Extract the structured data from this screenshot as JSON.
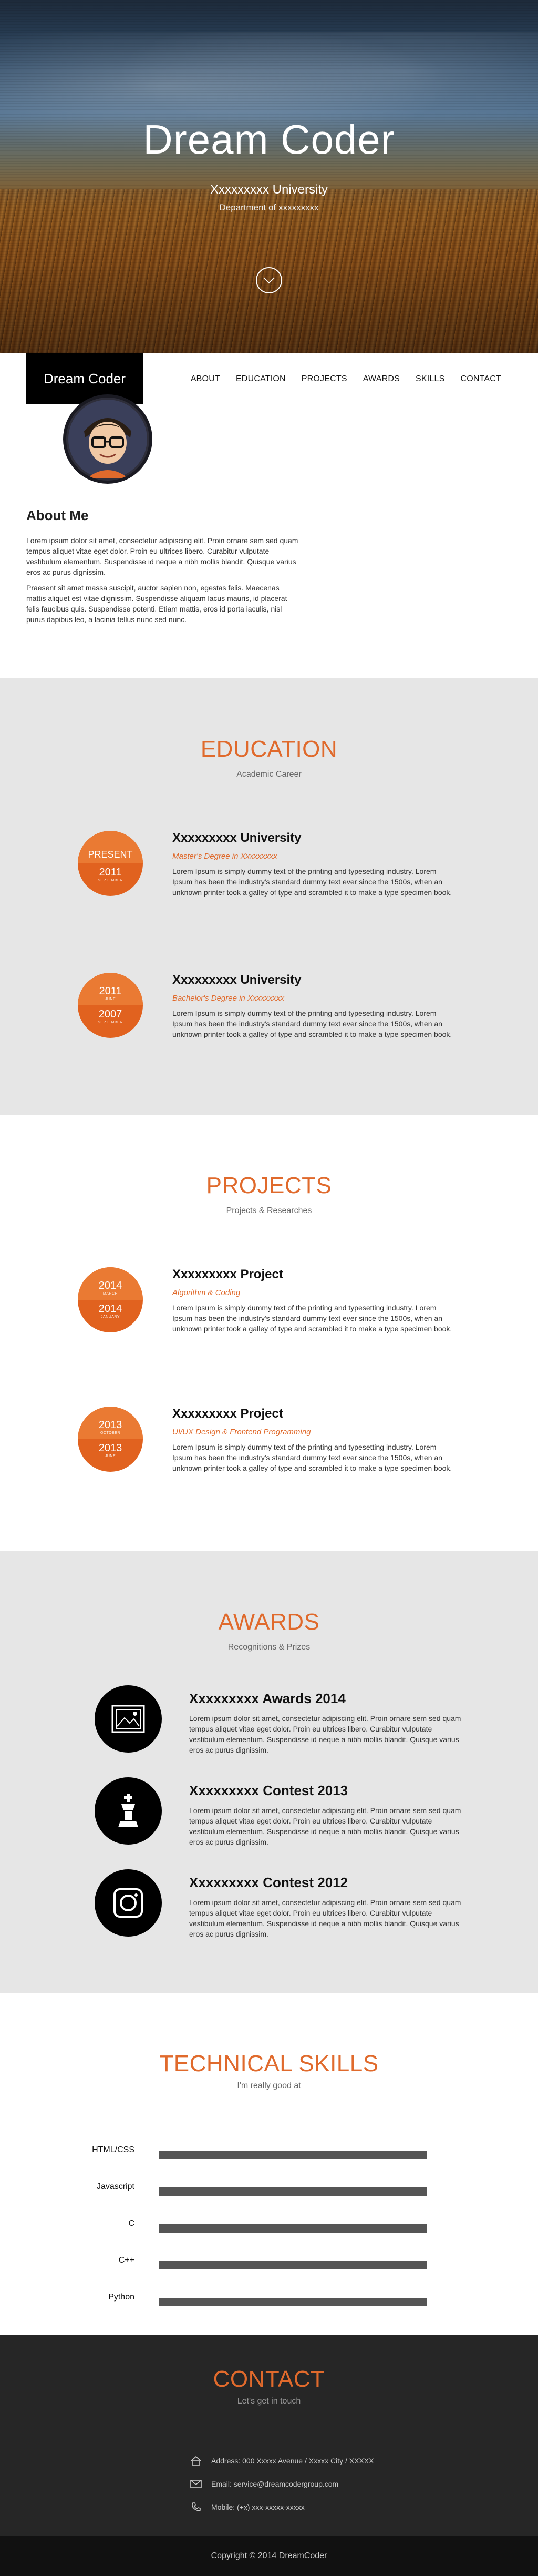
{
  "hero": {
    "title": "Dream Coder",
    "university": "Xxxxxxxxx University",
    "department": "Department of xxxxxxxxx",
    "scroll_icon": "chevron-down-icon"
  },
  "nav": {
    "brand": "Dream Coder",
    "items": [
      "ABOUT",
      "EDUCATION",
      "PROJECTS",
      "AWARDS",
      "SKILLS",
      "CONTACT"
    ]
  },
  "about": {
    "title": "About Me",
    "paragraphs": [
      "Lorem ipsum dolor sit amet, consectetur adipiscing elit. Proin ornare sem sed quam tempus aliquet vitae eget dolor. Proin eu ultrices libero. Curabitur vulputate vestibulum elementum. Suspendisse id neque a nibh mollis blandit. Quisque varius eros ac purus dignissim.",
      "Praesent sit amet massa suscipit, auctor sapien non, egestas felis. Maecenas mattis aliquet est vitae dignissim. Suspendisse aliquam lacus mauris, id placerat felis faucibus quis. Suspendisse potenti. Etiam mattis, eros id porta iaculis, nisl purus dapibus leo, a lacinia tellus nunc sed nunc."
    ]
  },
  "education": {
    "title": "EDUCATION",
    "subtitle": "Academic Career",
    "items": [
      {
        "top": "PRESENT",
        "top_small": "",
        "bottom": "2011",
        "bottom_small": "SEPTEMBER",
        "name": "Xxxxxxxxx University",
        "role": "Master's Degree in Xxxxxxxxx",
        "text": "Lorem Ipsum is simply dummy text of the printing and typesetting industry. Lorem Ipsum has been the industry's standard dummy text ever since the 1500s, when an unknown printer took a galley of type and scrambled it to make a type specimen book."
      },
      {
        "top": "2011",
        "top_small": "JUNE",
        "bottom": "2007",
        "bottom_small": "SEPTEMBER",
        "name": "Xxxxxxxxx University",
        "role": "Bachelor's Degree in Xxxxxxxxx",
        "text": "Lorem Ipsum is simply dummy text of the printing and typesetting industry. Lorem Ipsum has been the industry's standard dummy text ever since the 1500s, when an unknown printer took a galley of type and scrambled it to make a type specimen book."
      }
    ]
  },
  "projects": {
    "title": "PROJECTS",
    "subtitle": "Projects & Researches",
    "items": [
      {
        "top": "2014",
        "top_small": "MARCH",
        "bottom": "2014",
        "bottom_small": "JANUARY",
        "name": "Xxxxxxxxx Project",
        "role": "Algorithm & Coding",
        "text": "Lorem Ipsum is simply dummy text of the printing and typesetting industry. Lorem Ipsum has been the industry's standard dummy text ever since the 1500s, when an unknown printer took a galley of type and scrambled it to make a type specimen book."
      },
      {
        "top": "2013",
        "top_small": "OCTOBER",
        "bottom": "2013",
        "bottom_small": "JUNE",
        "name": "Xxxxxxxxx Project",
        "role": "UI/UX Design & Frontend Programming",
        "text": "Lorem Ipsum is simply dummy text of the printing and typesetting industry. Lorem Ipsum has been the industry's standard dummy text ever since the 1500s, when an unknown printer took a galley of type and scrambled it to make a type specimen book."
      }
    ]
  },
  "awards": {
    "title": "AWARDS",
    "subtitle": "Recognitions & Prizes",
    "items": [
      {
        "name": "Xxxxxxxxx Awards 2014",
        "icon": "picture-frame-icon",
        "text": "Lorem ipsum dolor sit amet, consectetur adipiscing elit. Proin ornare sem sed quam tempus aliquet vitae eget dolor. Proin eu ultrices libero. Curabitur vulputate vestibulum elementum. Suspendisse id neque a nibh mollis blandit. Quisque varius eros ac purus dignissim."
      },
      {
        "name": "Xxxxxxxxx Contest 2013",
        "icon": "chess-king-icon",
        "text": "Lorem ipsum dolor sit amet, consectetur adipiscing elit. Proin ornare sem sed quam tempus aliquet vitae eget dolor. Proin eu ultrices libero. Curabitur vulputate vestibulum elementum. Suspendisse id neque a nibh mollis blandit. Quisque varius eros ac purus dignissim."
      },
      {
        "name": "Xxxxxxxxx Contest 2012",
        "icon": "camera-icon",
        "text": "Lorem ipsum dolor sit amet, consectetur adipiscing elit. Proin ornare sem sed quam tempus aliquet vitae eget dolor. Proin eu ultrices libero. Curabitur vulputate vestibulum elementum. Suspendisse id neque a nibh mollis blandit. Quisque varius eros ac purus dignissim."
      }
    ]
  },
  "skills": {
    "title": "TECHNICAL SKILLS",
    "subtitle": "I'm really good at",
    "items": [
      {
        "name": "HTML/CSS",
        "level": 1.0
      },
      {
        "name": "Javascript",
        "level": 1.0
      },
      {
        "name": "C",
        "level": 1.0
      },
      {
        "name": "C++",
        "level": 1.0
      },
      {
        "name": "Python",
        "level": 1.0
      }
    ]
  },
  "contact": {
    "title": "CONTACT",
    "subtitle": "Let's get in touch",
    "address": "Address: 000 Xxxxx Avenue / Xxxxx City / XXXXX",
    "email": "Email: service@dreamcodergroup.com",
    "mobile": "Mobile: (+x) xxx-xxxxx-xxxxx"
  },
  "footer": {
    "copyright": "Copyright © 2014 DreamCoder"
  },
  "colors": {
    "accent": "#e06a2c",
    "section_gray": "#e6e6e6",
    "contact_bg": "#262626",
    "footer_bg": "#111111"
  }
}
